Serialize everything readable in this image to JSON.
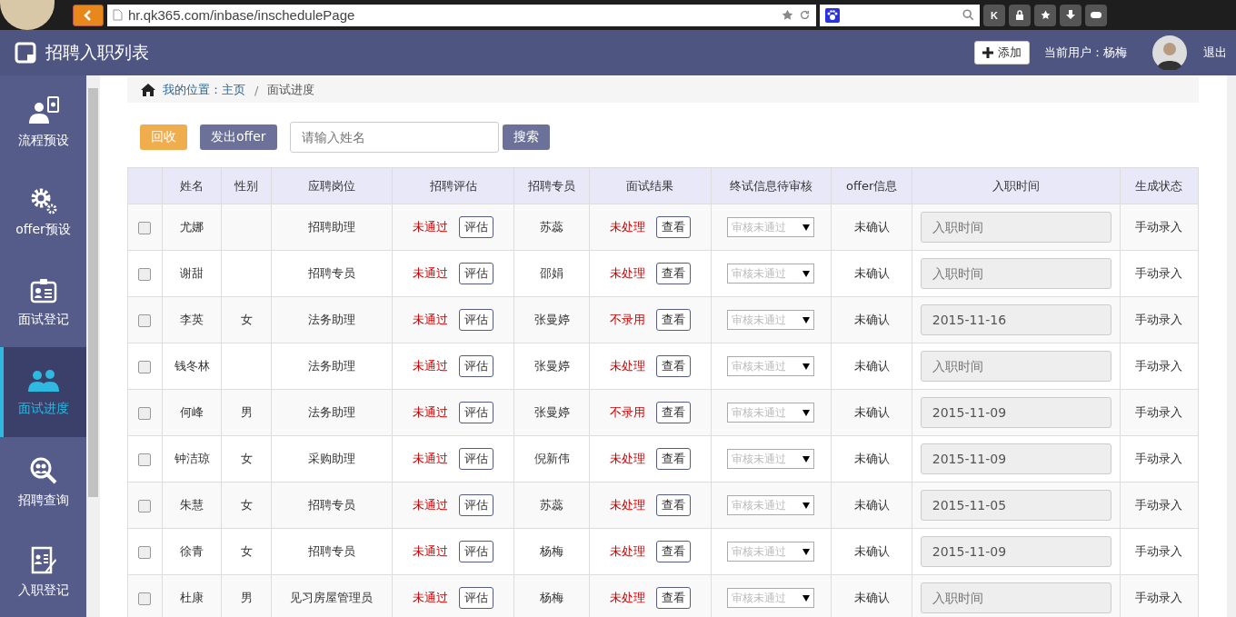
{
  "browser": {
    "url": "hr.qk365.com/inbase/inschedulePage",
    "toolbar_buttons": [
      "K"
    ]
  },
  "header": {
    "title": "招聘入职列表",
    "add_button": "添加",
    "current_user": "当前用户：杨梅",
    "logout": "退出"
  },
  "sidebar": {
    "items": [
      {
        "label": "流程预设",
        "selected": false
      },
      {
        "label": "offer预设",
        "selected": false
      },
      {
        "label": "面试登记",
        "selected": false
      },
      {
        "label": "面试进度",
        "selected": true
      },
      {
        "label": "招聘查询",
        "selected": false
      },
      {
        "label": "入职登记",
        "selected": false
      }
    ]
  },
  "breadcrumb": {
    "prefix": "我的位置：",
    "home": "主页",
    "separator": "/",
    "current": "面试进度"
  },
  "toolbar": {
    "recall": "回收",
    "send_offer": "发出offer",
    "search": {
      "placeholder": "请输入姓名"
    },
    "search_button": "搜索"
  },
  "table": {
    "columns": [
      "姓名",
      "性别",
      "应聘岗位",
      "招聘评估",
      "招聘专员",
      "面试结果",
      "终试信息待审核",
      "offer信息",
      "入职时间",
      "生成状态"
    ],
    "rows": [
      {
        "checked": false,
        "name": "尤娜",
        "gender": "",
        "position": "招聘助理",
        "evaluation": "未通过",
        "evaluate_button": "评估",
        "specialist": "苏蕊",
        "result": "未处理",
        "view_button": "查看",
        "review": {
          "value": "审核未通过",
          "disabled": true
        },
        "offer": "未确认",
        "entry_time": {
          "placeholder": "入职时间"
        },
        "status": "手动录入"
      },
      {
        "checked": false,
        "name": "谢甜",
        "gender": "",
        "position": "招聘专员",
        "evaluation": "未通过",
        "evaluate_button": "评估",
        "specialist": "邵娟",
        "result": "未处理",
        "view_button": "查看",
        "review": {
          "value": "审核未通过",
          "disabled": true
        },
        "offer": "未确认",
        "entry_time": {
          "placeholder": "入职时间"
        },
        "status": "手动录入"
      },
      {
        "checked": false,
        "name": "李英",
        "gender": "女",
        "position": "法务助理",
        "evaluation": "未通过",
        "evaluate_button": "评估",
        "specialist": "张曼婷",
        "result": "不录用",
        "view_button": "查看",
        "review": {
          "value": "审核未通过",
          "disabled": true
        },
        "offer": "未确认",
        "entry_time": {
          "value": "2015-11-16"
        },
        "status": "手动录入"
      },
      {
        "checked": false,
        "name": "钱冬林",
        "gender": "",
        "position": "法务助理",
        "evaluation": "未通过",
        "evaluate_button": "评估",
        "specialist": "张曼婷",
        "result": "未处理",
        "view_button": "查看",
        "review": {
          "value": "审核未通过",
          "disabled": true
        },
        "offer": "未确认",
        "entry_time": {
          "placeholder": "入职时间"
        },
        "status": "手动录入"
      },
      {
        "checked": false,
        "name": "何峰",
        "gender": "男",
        "position": "法务助理",
        "evaluation": "未通过",
        "evaluate_button": "评估",
        "specialist": "张曼婷",
        "result": "不录用",
        "view_button": "查看",
        "review": {
          "value": "审核未通过",
          "disabled": true
        },
        "offer": "未确认",
        "entry_time": {
          "value": "2015-11-09"
        },
        "status": "手动录入"
      },
      {
        "checked": false,
        "name": "钟洁琼",
        "gender": "女",
        "position": "采购助理",
        "evaluation": "未通过",
        "evaluate_button": "评估",
        "specialist": "倪新伟",
        "result": "未处理",
        "view_button": "查看",
        "review": {
          "value": "审核未通过",
          "disabled": true
        },
        "offer": "未确认",
        "entry_time": {
          "value": "2015-11-09"
        },
        "status": "手动录入"
      },
      {
        "checked": false,
        "name": "朱慧",
        "gender": "女",
        "position": "招聘专员",
        "evaluation": "未通过",
        "evaluate_button": "评估",
        "specialist": "苏蕊",
        "result": "未处理",
        "view_button": "查看",
        "review": {
          "value": "审核未通过",
          "disabled": true
        },
        "offer": "未确认",
        "entry_time": {
          "value": "2015-11-05"
        },
        "status": "手动录入"
      },
      {
        "checked": false,
        "name": "徐青",
        "gender": "女",
        "position": "招聘专员",
        "evaluation": "未通过",
        "evaluate_button": "评估",
        "specialist": "杨梅",
        "result": "未处理",
        "view_button": "查看",
        "review": {
          "value": "审核未通过",
          "disabled": true
        },
        "offer": "未确认",
        "entry_time": {
          "value": "2015-11-09"
        },
        "status": "手动录入"
      },
      {
        "checked": false,
        "name": "杜康",
        "gender": "男",
        "position": "见习房屋管理员",
        "evaluation": "未通过",
        "evaluate_button": "评估",
        "specialist": "杨梅",
        "result": "未处理",
        "view_button": "查看",
        "review": {
          "value": "审核未通过",
          "disabled": true
        },
        "offer": "未确认",
        "entry_time": {
          "placeholder": "入职时间"
        },
        "status": "手动录入"
      }
    ]
  }
}
